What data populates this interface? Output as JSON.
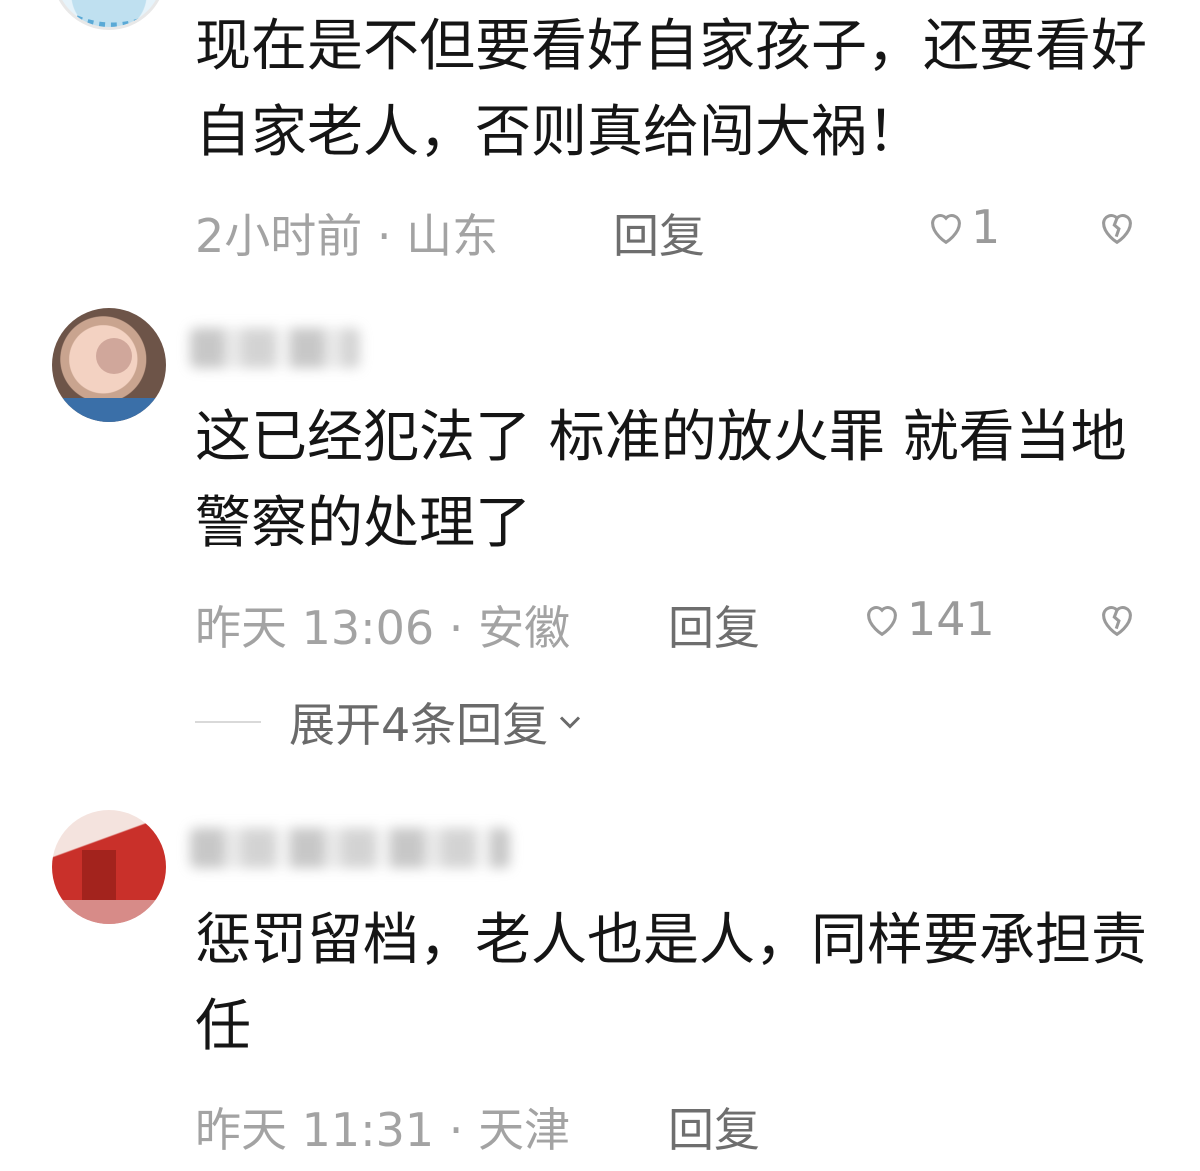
{
  "comments": [
    {
      "text": "现在是不但要看好自家孩子，还要看好自家老人，否则真给闯大祸！",
      "time": "2小时前",
      "location": "山东",
      "reply_label": "回复",
      "likes": "1"
    },
    {
      "text": "这已经犯法了 标准的放火罪 就看当地警察的处理了",
      "time": "昨天 13:06",
      "location": "安徽",
      "reply_label": "回复",
      "likes": "141",
      "expand_label": "展开4条回复"
    },
    {
      "text": "惩罚留档，老人也是人，同样要承担责任",
      "time": "昨天 11:31",
      "location": "天津",
      "reply_label": "回复"
    }
  ],
  "icons": {
    "like": "heart-outline-icon",
    "dislike": "broken-heart-icon",
    "expand": "chevron-down-icon"
  }
}
